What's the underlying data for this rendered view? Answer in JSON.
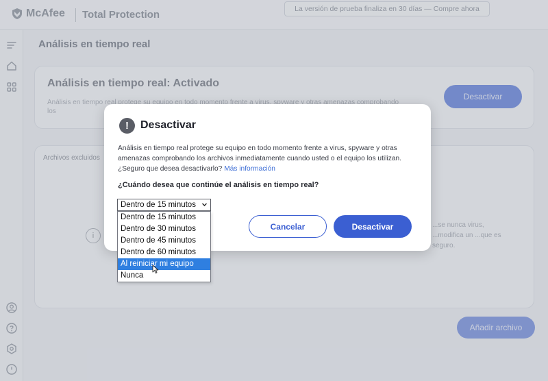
{
  "app": {
    "brand": "McAfee",
    "product": "Total Protection",
    "trial_notice": "La versión de prueba finaliza en 30 días — Compre ahora"
  },
  "sidebar": {
    "icons": [
      "menu-icon",
      "home-icon",
      "apps-grid-icon",
      "account-icon",
      "help-icon",
      "settings-icon",
      "power-icon"
    ]
  },
  "main": {
    "page_title": "Análisis en tiempo real",
    "status_card": {
      "title": "Análisis en tiempo real: Activado",
      "description": "Análisis en tiempo real protege su equipo en todo momento frente a virus, spyware y otras amenazas comprobando los",
      "deactivate_label": "Desactivar"
    },
    "excluded_card": {
      "label": "Archivos excluidos",
      "side_text": "...se nunca virus, ...modifica un ...que es seguro.",
      "add_file_label": "Añadir archivo"
    }
  },
  "dialog": {
    "title": "Desactivar",
    "body": "Análisis en tiempo real protege su equipo en todo momento frente a virus, spyware y otras amenazas comprobando los archivos inmediatamente cuando usted o el equipo los utilizan. ¿Seguro que desea desactivarlo?",
    "more_link": "Más información",
    "question": "¿Cuándo desea que continúe el análisis en tiempo real?",
    "select": {
      "value": "Dentro de 15 minutos",
      "options": [
        "Dentro de 15 minutos",
        "Dentro de 30 minutos",
        "Dentro de 45 minutos",
        "Dentro de 60 minutos",
        "Al reiniciar mi equipo",
        "Nunca"
      ],
      "highlighted_index": 4
    },
    "cancel_label": "Cancelar",
    "confirm_label": "Desactivar"
  },
  "colors": {
    "primary": "#3b5fd2",
    "highlight": "#2f7fe0"
  }
}
